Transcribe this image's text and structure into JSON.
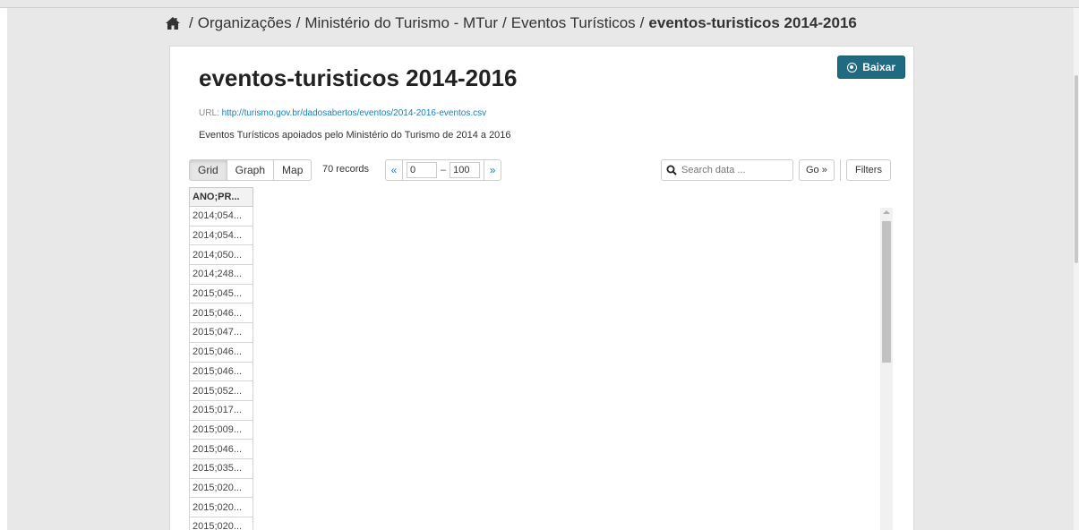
{
  "breadcrumb": {
    "separator": "/",
    "items": [
      "Organizações",
      "Ministério do Turismo - MTur",
      "Eventos Turísticos"
    ],
    "current": "eventos-turisticos 2014-2016"
  },
  "dataset": {
    "title": "eventos-turisticos 2014-2016",
    "download_label": "Baixar",
    "url_label": "URL:",
    "url": "http://turismo.gov.br/dadosabertos/eventos/2014-2016-eventos.csv",
    "description": "Eventos Turísticos apoiados pelo Ministério do Turismo de 2014 a 2016"
  },
  "toolbar": {
    "views": [
      "Grid",
      "Graph",
      "Map"
    ],
    "active_view": "Grid",
    "records": "70 records",
    "prev": "«",
    "next": "»",
    "from": "0",
    "dash": "–",
    "to": "100",
    "search_placeholder": "Search data ...",
    "go_label": "Go »",
    "filters_label": "Filters"
  },
  "grid": {
    "header": "ANO;PR...",
    "rows": [
      "2014;054...",
      "2014;054...",
      "2014;050...",
      "2014;248...",
      "2015;045...",
      "2015;046...",
      "2015;047...",
      "2015;046...",
      "2015;046...",
      "2015;052...",
      "2015;017...",
      "2015;009...",
      "2015;046...",
      "2015;035...",
      "2015;020...",
      "2015;020...",
      "2015;020..."
    ]
  },
  "colors": {
    "accent": "#206b82",
    "link": "#1a7fb5",
    "background": "#e8e8e8"
  },
  "icons": {
    "home": "home-icon",
    "download": "download-icon",
    "search": "search-icon"
  }
}
